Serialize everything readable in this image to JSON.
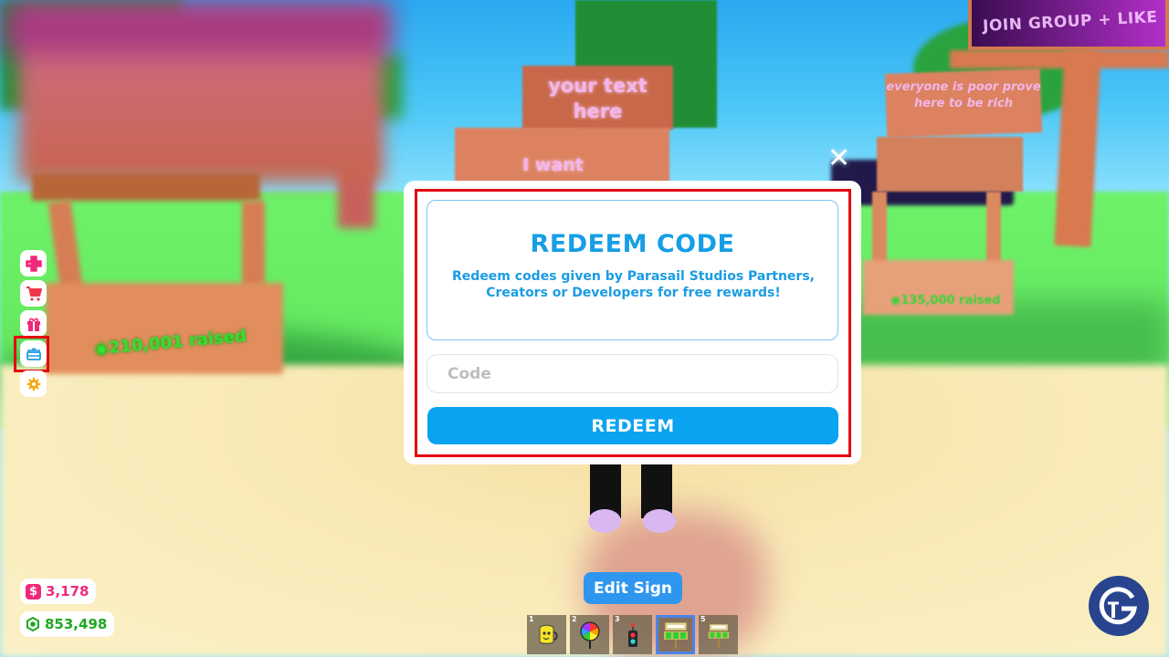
{
  "scene": {
    "sign_top_text": "your text here",
    "sign_mid_text": "I want",
    "billboard_text": "JOIN GROUP + LIKE",
    "right_sign_text": "everyone is poor prove here to be rich",
    "left_stand_raised": "◉210,001 raised",
    "right_stand_raised": "◉135,000 raised"
  },
  "dialog": {
    "title": "REDEEM CODE",
    "description": "Redeem codes given by Parasail Studios Partners, Creators or Developers for free rewards!",
    "code_input": {
      "value": "",
      "placeholder": "Code"
    },
    "redeem_label": "REDEEM",
    "close_icon": "close-icon",
    "highlighted": true
  },
  "side_menu": {
    "items": [
      {
        "name": "heal",
        "icon": "health-plus-icon",
        "color": "#f0287a"
      },
      {
        "name": "shop",
        "icon": "shopping-cart-icon",
        "color": "#f2364a"
      },
      {
        "name": "gifts",
        "icon": "gift-icon",
        "color": "#f0287a"
      },
      {
        "name": "redeem-codes",
        "icon": "treasure-chest-icon",
        "color": "#1a9ce3",
        "highlighted": true
      },
      {
        "name": "settings",
        "icon": "gear-icon",
        "color": "#f6a90d"
      }
    ]
  },
  "currency": {
    "cash": {
      "icon": "dollar-icon",
      "value": "3,178",
      "color": "#f0287a"
    },
    "robux": {
      "icon": "robux-icon",
      "value": "853,498",
      "color": "#1fa81f"
    }
  },
  "edit_sign_label": "Edit Sign",
  "hotbar": {
    "slots": [
      {
        "number": "1",
        "item": "yellow-mug-icon",
        "selected": false
      },
      {
        "number": "2",
        "item": "rainbow-lollipop-sign-icon",
        "selected": false
      },
      {
        "number": "3",
        "item": "traffic-light-icon",
        "selected": false
      },
      {
        "number": "",
        "item": "green-sign-icon",
        "selected": true
      },
      {
        "number": "5",
        "item": "green-sign-icon",
        "selected": false
      }
    ]
  },
  "watermark": {
    "name": "gamer-tweak-logo"
  }
}
